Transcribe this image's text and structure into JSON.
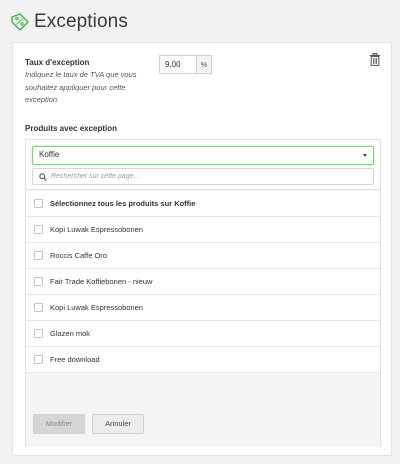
{
  "header": {
    "title": "Exceptions",
    "icon": "tag-percent-icon",
    "accent": "#46b04a"
  },
  "rate": {
    "label": "Taux d'exception",
    "help": "Indiquez le taux de TVA que vous souhaitez appliquer pour cette exception.",
    "value": "9,00",
    "unit": "%"
  },
  "products": {
    "label": "Produits avec exception",
    "category_selected": "Koffie",
    "search_placeholder": "Rechercher sur cette page...",
    "select_all": "Sélectionnez tous les produits sur Koffie",
    "items": [
      {
        "label": "Kopi Luwak Espressobonen",
        "checked": false
      },
      {
        "label": "Roccis Caffe Oro",
        "checked": false
      },
      {
        "label": "Fair Trade Koffiebonen - nieuw",
        "checked": false
      },
      {
        "label": "Kopi Luwak Espressobonen",
        "checked": false
      },
      {
        "label": "Glazen mok",
        "checked": false
      },
      {
        "label": "Free download",
        "checked": false
      }
    ]
  },
  "actions": {
    "submit": "Modifier",
    "cancel": "Annuler"
  }
}
